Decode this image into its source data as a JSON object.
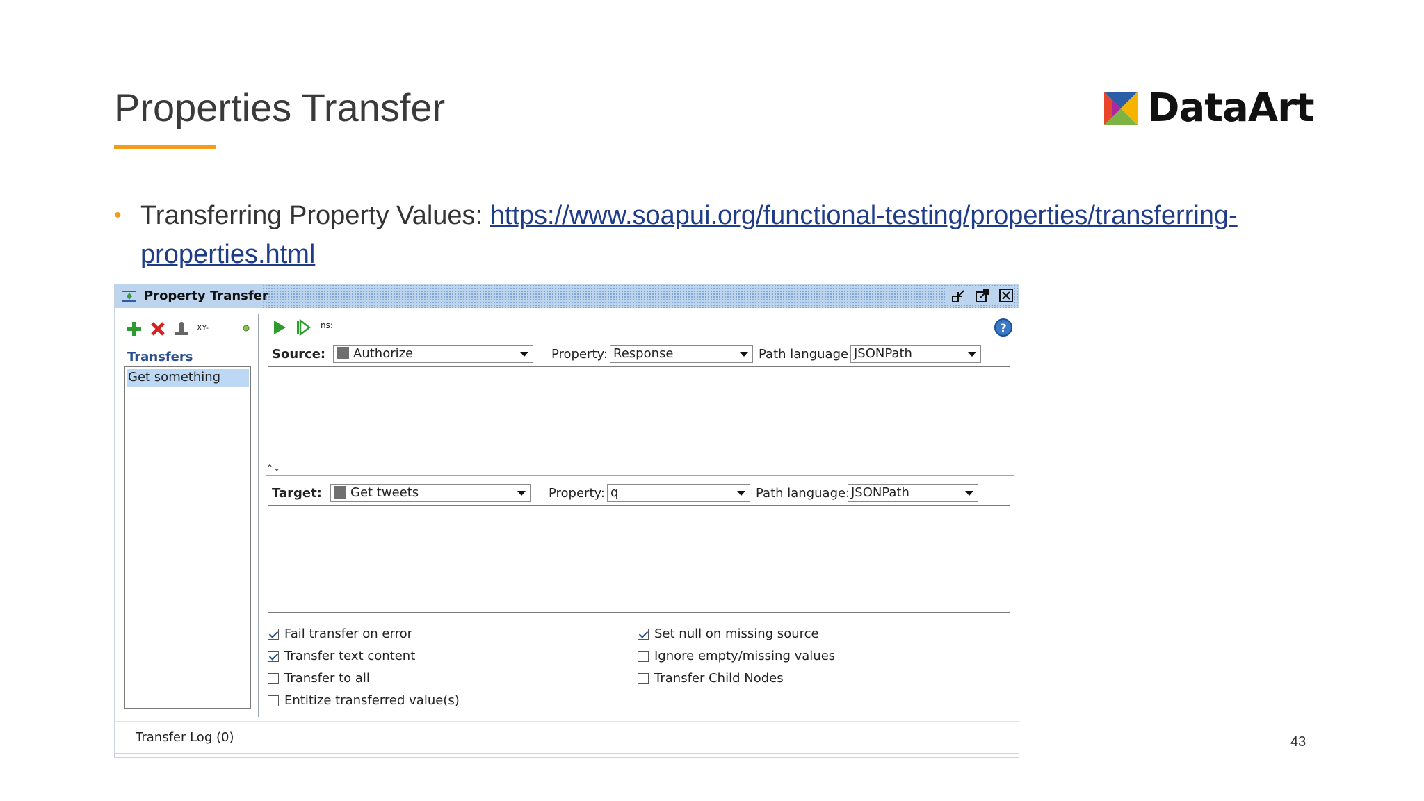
{
  "slide": {
    "title": "Properties Transfer",
    "page_number": "43",
    "accent_color": "#f39c1a"
  },
  "logo": {
    "text": "DataArt"
  },
  "bullet": {
    "prefix": "Transferring Property Values: ",
    "link_text": "https://www.soapui.org/functional-testing/properties/transferring-properties.html"
  },
  "window": {
    "title": "Property Transfer",
    "titlebar_buttons": [
      "minimize-icon",
      "maximize-icon",
      "close-icon"
    ],
    "left_toolbar_icons": [
      "add-icon",
      "delete-icon",
      "rename-icon",
      "xpath-icon",
      "status-icon"
    ],
    "left_toolbar_xy": "XY-",
    "transfers_heading": "Transfers",
    "transfers": [
      "Get something"
    ],
    "right_toolbar_icons": [
      "run-icon",
      "run-all-icon",
      "help-icon"
    ],
    "ns_label": "ns:",
    "source": {
      "label": "Source:",
      "step": "Authorize",
      "property_label": "Property:",
      "property": "Response",
      "path_language_label": "Path language:",
      "path_language": "JSONPath"
    },
    "target": {
      "label": "Target:",
      "step": "Get tweets",
      "property_label": "Property:",
      "property": "q",
      "path_language_label": "Path language:",
      "path_language": "JSONPath"
    },
    "options_left": [
      {
        "label": "Fail transfer on error",
        "checked": true
      },
      {
        "label": "Transfer text content",
        "checked": true
      },
      {
        "label": "Transfer to all",
        "checked": false
      },
      {
        "label": "Entitize transferred value(s)",
        "checked": false
      }
    ],
    "options_right": [
      {
        "label": "Set null on missing source",
        "checked": true
      },
      {
        "label": "Ignore empty/missing values",
        "checked": false
      },
      {
        "label": "Transfer Child Nodes",
        "checked": false
      }
    ],
    "log_label": "Transfer Log (0)"
  }
}
